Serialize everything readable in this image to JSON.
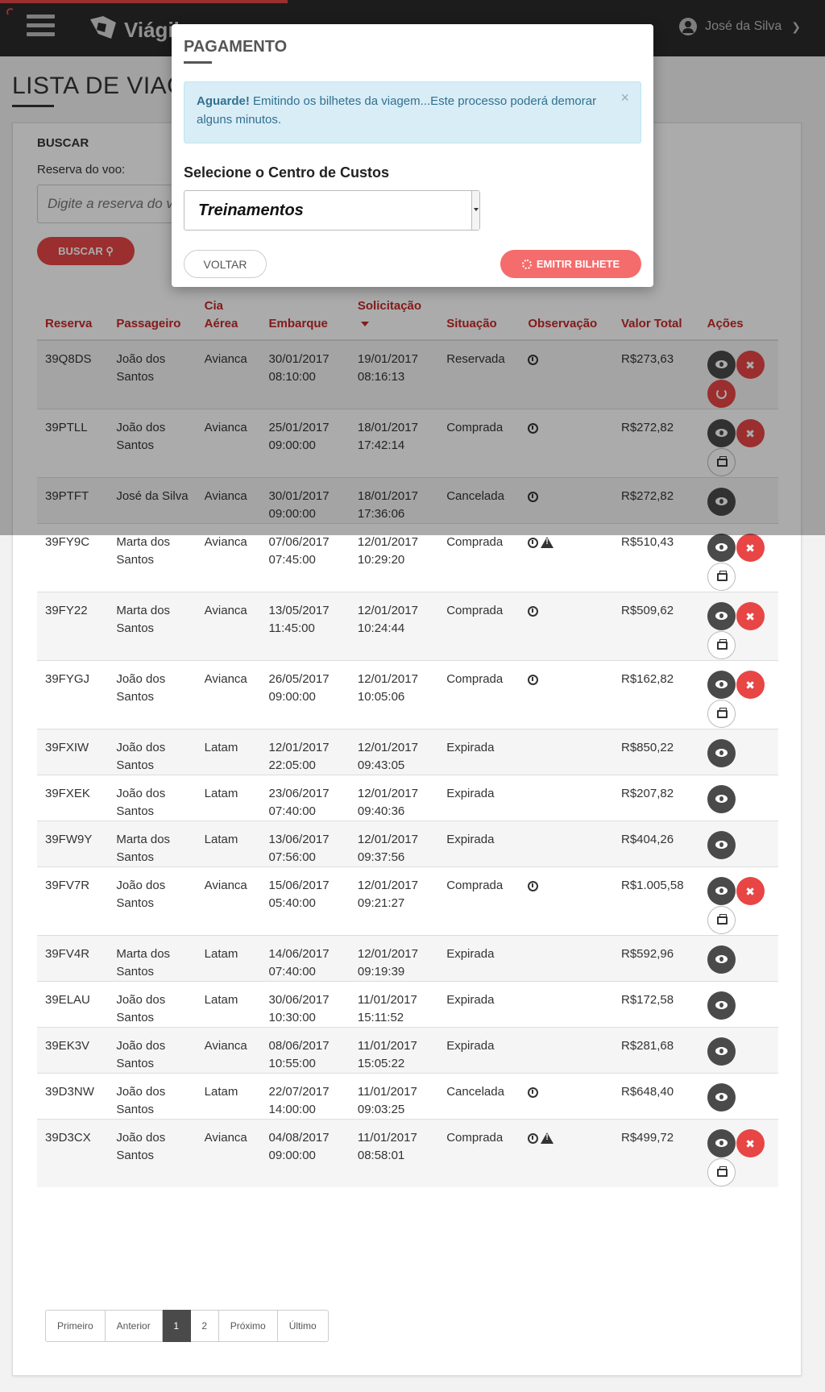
{
  "app": {
    "brand": "Viágil",
    "user_name": "José da Silva"
  },
  "page": {
    "title": "LISTA DE VIAGENS"
  },
  "search": {
    "heading": "BUSCAR",
    "label": "Reserva do voo:",
    "placeholder": "Digite a reserva do voo",
    "button": "BUSCAR"
  },
  "table": {
    "headers": [
      "Reserva",
      "Passageiro",
      "Cia Aérea",
      "Embarque",
      "Solicitação",
      "Situação",
      "Observação",
      "Valor Total",
      "Ações"
    ],
    "rows": [
      {
        "reserva": "39Q8DS",
        "passageiro": "João dos Santos",
        "cia": "Avianca",
        "embarque": "30/01/2017 08:10:00",
        "solicitacao": "19/01/2017 08:16:13",
        "situacao": "Reservada",
        "obs": [
          "clock-icon"
        ],
        "valor": "R$273,63",
        "acoes": [
          "view",
          "cancel",
          "reload"
        ]
      },
      {
        "reserva": "39PTLL",
        "passageiro": "João dos Santos",
        "cia": "Avianca",
        "embarque": "25/01/2017 09:00:00",
        "solicitacao": "18/01/2017 17:42:14",
        "situacao": "Comprada",
        "obs": [
          "clock-icon"
        ],
        "valor": "R$272,82",
        "acoes": [
          "view",
          "cancel",
          "print"
        ]
      },
      {
        "reserva": "39PTFT",
        "passageiro": "José da Silva",
        "cia": "Avianca",
        "embarque": "30/01/2017 09:00:00",
        "solicitacao": "18/01/2017 17:36:06",
        "situacao": "Cancelada",
        "obs": [
          "clock-icon"
        ],
        "valor": "R$272,82",
        "acoes": [
          "view"
        ]
      },
      {
        "reserva": "39FY9C",
        "passageiro": "Marta dos Santos",
        "cia": "Avianca",
        "embarque": "07/06/2017 07:45:00",
        "solicitacao": "12/01/2017 10:29:20",
        "situacao": "Comprada",
        "obs": [
          "clock-icon",
          "warning-icon"
        ],
        "valor": "R$510,43",
        "acoes": [
          "view",
          "cancel",
          "print"
        ]
      },
      {
        "reserva": "39FY22",
        "passageiro": "Marta dos Santos",
        "cia": "Avianca",
        "embarque": "13/05/2017 11:45:00",
        "solicitacao": "12/01/2017 10:24:44",
        "situacao": "Comprada",
        "obs": [
          "clock-icon"
        ],
        "valor": "R$509,62",
        "acoes": [
          "view",
          "cancel",
          "print"
        ]
      },
      {
        "reserva": "39FYGJ",
        "passageiro": "João dos Santos",
        "cia": "Avianca",
        "embarque": "26/05/2017 09:00:00",
        "solicitacao": "12/01/2017 10:05:06",
        "situacao": "Comprada",
        "obs": [
          "clock-icon"
        ],
        "valor": "R$162,82",
        "acoes": [
          "view",
          "cancel",
          "print"
        ]
      },
      {
        "reserva": "39FXIW",
        "passageiro": "João dos Santos",
        "cia": "Latam",
        "embarque": "12/01/2017 22:05:00",
        "solicitacao": "12/01/2017 09:43:05",
        "situacao": "Expirada",
        "obs": [],
        "valor": "R$850,22",
        "acoes": [
          "view"
        ]
      },
      {
        "reserva": "39FXEK",
        "passageiro": "João dos Santos",
        "cia": "Latam",
        "embarque": "23/06/2017 07:40:00",
        "solicitacao": "12/01/2017 09:40:36",
        "situacao": "Expirada",
        "obs": [],
        "valor": "R$207,82",
        "acoes": [
          "view"
        ]
      },
      {
        "reserva": "39FW9Y",
        "passageiro": "Marta dos Santos",
        "cia": "Latam",
        "embarque": "13/06/2017 07:56:00",
        "solicitacao": "12/01/2017 09:37:56",
        "situacao": "Expirada",
        "obs": [],
        "valor": "R$404,26",
        "acoes": [
          "view"
        ]
      },
      {
        "reserva": "39FV7R",
        "passageiro": "João dos Santos",
        "cia": "Avianca",
        "embarque": "15/06/2017 05:40:00",
        "solicitacao": "12/01/2017 09:21:27",
        "situacao": "Comprada",
        "obs": [
          "clock-icon"
        ],
        "valor": "R$1.005,58",
        "acoes": [
          "view",
          "cancel",
          "print"
        ]
      },
      {
        "reserva": "39FV4R",
        "passageiro": "Marta dos Santos",
        "cia": "Latam",
        "embarque": "14/06/2017 07:40:00",
        "solicitacao": "12/01/2017 09:19:39",
        "situacao": "Expirada",
        "obs": [],
        "valor": "R$592,96",
        "acoes": [
          "view"
        ]
      },
      {
        "reserva": "39ELAU",
        "passageiro": "João dos Santos",
        "cia": "Latam",
        "embarque": "30/06/2017 10:30:00",
        "solicitacao": "11/01/2017 15:11:52",
        "situacao": "Expirada",
        "obs": [],
        "valor": "R$172,58",
        "acoes": [
          "view"
        ]
      },
      {
        "reserva": "39EK3V",
        "passageiro": "João dos Santos",
        "cia": "Avianca",
        "embarque": "08/06/2017 10:55:00",
        "solicitacao": "11/01/2017 15:05:22",
        "situacao": "Expirada",
        "obs": [],
        "valor": "R$281,68",
        "acoes": [
          "view"
        ]
      },
      {
        "reserva": "39D3NW",
        "passageiro": "João dos Santos",
        "cia": "Latam",
        "embarque": "22/07/2017 14:00:00",
        "solicitacao": "11/01/2017 09:03:25",
        "situacao": "Cancelada",
        "obs": [
          "clock-icon"
        ],
        "valor": "R$648,40",
        "acoes": [
          "view"
        ]
      },
      {
        "reserva": "39D3CX",
        "passageiro": "João dos Santos",
        "cia": "Avianca",
        "embarque": "04/08/2017 09:00:00",
        "solicitacao": "11/01/2017 08:58:01",
        "situacao": "Comprada",
        "obs": [
          "clock-icon",
          "warning-icon"
        ],
        "valor": "R$499,72",
        "acoes": [
          "view",
          "cancel",
          "print"
        ]
      }
    ]
  },
  "pagination": {
    "items": [
      "Primeiro",
      "Anterior",
      "1",
      "2",
      "Próximo",
      "Último"
    ],
    "active": "1"
  },
  "modal": {
    "title": "PAGAMENTO",
    "alert_strong": "Aguarde!",
    "alert_text": " Emitindo os bilhetes da viagem...Este processo poderá demorar alguns minutos.",
    "alert_close": "×",
    "cost_center_label": "Selecione o Centro de Custos",
    "cost_center_value": "Treinamentos",
    "back_button": "VOLTAR",
    "emit_button": "EMITIR BILHETE"
  },
  "colors": {
    "accent": "#e84545",
    "header_bg": "#2b2b2b",
    "alert_bg": "#d9edf7"
  }
}
